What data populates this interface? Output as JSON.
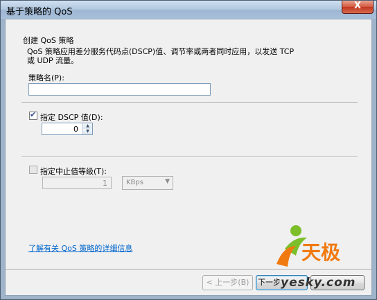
{
  "window": {
    "title": "基于策略的 QoS",
    "close_label": "X"
  },
  "header": {
    "heading": "创建 QoS 策略",
    "description_line1": "QoS 策略应用差分服务代码点(DSCP)值、调节率或两者同时应用，以发送 TCP",
    "description_line2": "或 UDP 流量。"
  },
  "policy_name": {
    "label": "策略名(P):",
    "value": ""
  },
  "dscp": {
    "label": "指定 DSCP 值(D):",
    "checked": true,
    "value": "0"
  },
  "throttle": {
    "label": "指定中止值等级(T):",
    "checked": false,
    "value": "1",
    "unit": "KBps"
  },
  "help_link": "了解有关 QoS 策略的详细信息",
  "buttons": {
    "back": "< 上一步(B)",
    "next": "下一步"
  },
  "watermark": {
    "text": "天极",
    "url_text": "yesky.com"
  },
  "colors": {
    "link": "#0066cc",
    "logo_orange": "#f07a10",
    "logo_green": "#7cbf2a"
  }
}
